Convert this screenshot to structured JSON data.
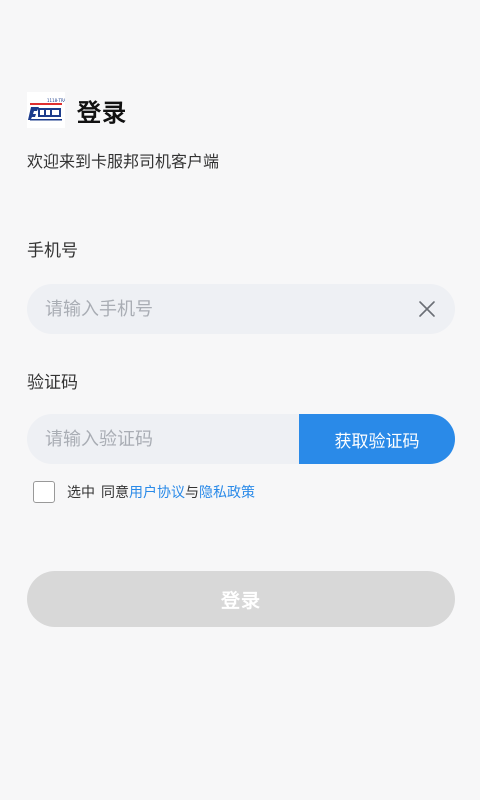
{
  "header": {
    "logo_icon": "kafubang-logo-icon",
    "title": "登录",
    "welcome": "欢迎来到卡服邦司机客户端"
  },
  "phone": {
    "label": "手机号",
    "placeholder": "请输入手机号",
    "value": "",
    "clear_icon": "close-icon"
  },
  "code": {
    "label": "验证码",
    "placeholder": "请输入验证码",
    "value": "",
    "get_code_label": "获取验证码"
  },
  "agreement": {
    "checked": false,
    "prefix": "选中",
    "agree_text": "同意",
    "user_agreement": "用户协议",
    "conjunction": "与",
    "privacy_policy": "隐私政策"
  },
  "login_button": {
    "label": "登录"
  },
  "colors": {
    "accent": "#2a8ae8",
    "background": "#f7f7f8",
    "input_bg": "#eef0f4",
    "disabled_button": "#d8d8d8"
  }
}
